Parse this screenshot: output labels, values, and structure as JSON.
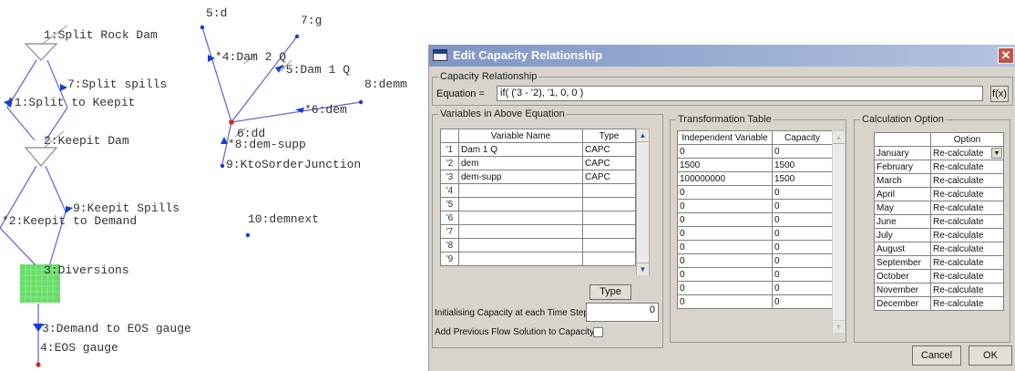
{
  "diagram": {
    "nodes": [
      {
        "id": "n1",
        "label": "1:Split Rock Dam"
      },
      {
        "id": "n2",
        "label": "2:Keepit Dam"
      },
      {
        "id": "n3",
        "label": "3:Diversions"
      },
      {
        "id": "n4",
        "label": "4:EOS gauge"
      },
      {
        "id": "n5",
        "label": "5:d"
      },
      {
        "id": "n6",
        "label": "6:dd"
      },
      {
        "id": "n7",
        "label": "7:g"
      },
      {
        "id": "n8",
        "label": "8:demm"
      },
      {
        "id": "n9",
        "label": "9:KtoSorderJunction"
      },
      {
        "id": "n10",
        "label": "10:demnext"
      }
    ],
    "links": [
      {
        "id": "l1",
        "label": "*1:Split to Keepit"
      },
      {
        "id": "l7",
        "label": "7:Split spills"
      },
      {
        "id": "l2",
        "label": "*2:Keepit to Demand"
      },
      {
        "id": "l9",
        "label": "9:Keepit Spills"
      },
      {
        "id": "l3",
        "label": "3:Demand to EOS gauge"
      },
      {
        "id": "l4",
        "label": "*4:Dam 2 Q"
      },
      {
        "id": "l5",
        "label": "*5:Dam 1 Q"
      },
      {
        "id": "l6",
        "label": "*6:dem"
      },
      {
        "id": "l8",
        "label": "*8:dem-supp"
      }
    ]
  },
  "dialog": {
    "title": "Edit Capacity Relationship",
    "close_label": "✕",
    "capacity_group_title": "Capacity Relationship",
    "equation_label": "Equation =",
    "equation_value": "if( ('3 - '2), '1, 0, 0 )",
    "fx_label": "f(x)",
    "variables_group_title": "Variables in Above Equation",
    "variables_headers": [
      "Variable Name",
      "Type"
    ],
    "variables_rows": [
      {
        "row": "'1",
        "name": "Dam 1 Q",
        "type": "CAPC"
      },
      {
        "row": "'2",
        "name": "dem",
        "type": "CAPC"
      },
      {
        "row": "'3",
        "name": "dem-supp",
        "type": "CAPC"
      },
      {
        "row": "'4",
        "name": "",
        "type": ""
      },
      {
        "row": "'5",
        "name": "",
        "type": ""
      },
      {
        "row": "'6",
        "name": "",
        "type": ""
      },
      {
        "row": "'7",
        "name": "",
        "type": ""
      },
      {
        "row": "'8",
        "name": "",
        "type": ""
      },
      {
        "row": "'9",
        "name": "",
        "type": ""
      }
    ],
    "type_button_label": "Type",
    "init_capacity_label": "Initialising Capacity at each Time Step",
    "init_capacity_value": "0",
    "add_prev_flow_label": "Add Previous Flow Solution to Capacity",
    "transformation_group_title": "Transformation Table",
    "transformation_headers": [
      "Independent Variable",
      "Capacity"
    ],
    "transformation_rows": [
      {
        "indep": "0",
        "cap": "0"
      },
      {
        "indep": "1500",
        "cap": "1500"
      },
      {
        "indep": "100000000",
        "cap": "1500"
      },
      {
        "indep": "0",
        "cap": "0"
      },
      {
        "indep": "0",
        "cap": "0"
      },
      {
        "indep": "0",
        "cap": "0"
      },
      {
        "indep": "0",
        "cap": "0"
      },
      {
        "indep": "0",
        "cap": "0"
      },
      {
        "indep": "0",
        "cap": "0"
      },
      {
        "indep": "0",
        "cap": "0"
      },
      {
        "indep": "0",
        "cap": "0"
      },
      {
        "indep": "0",
        "cap": "0"
      }
    ],
    "calculation_group_title": "Calculation Option",
    "calculation_header": "Option",
    "calculation_rows": [
      {
        "month": "January",
        "option": "Re-calculate"
      },
      {
        "month": "February",
        "option": "Re-calculate"
      },
      {
        "month": "March",
        "option": "Re-calculate"
      },
      {
        "month": "April",
        "option": "Re-calculate"
      },
      {
        "month": "May",
        "option": "Re-calculate"
      },
      {
        "month": "June",
        "option": "Re-calculate"
      },
      {
        "month": "July",
        "option": "Re-calculate"
      },
      {
        "month": "August",
        "option": "Re-calculate"
      },
      {
        "month": "September",
        "option": "Re-calculate"
      },
      {
        "month": "October",
        "option": "Re-calculate"
      },
      {
        "month": "November",
        "option": "Re-calculate"
      },
      {
        "month": "December",
        "option": "Re-calculate"
      }
    ],
    "cancel_label": "Cancel",
    "ok_label": "OK"
  },
  "colors": {
    "link_line": "#6b6bd6",
    "node_dot": "#1a3ad8",
    "red_dot": "#e02020",
    "diversion_fill": "#66dd66",
    "titlebar": "#8ea3cf"
  }
}
